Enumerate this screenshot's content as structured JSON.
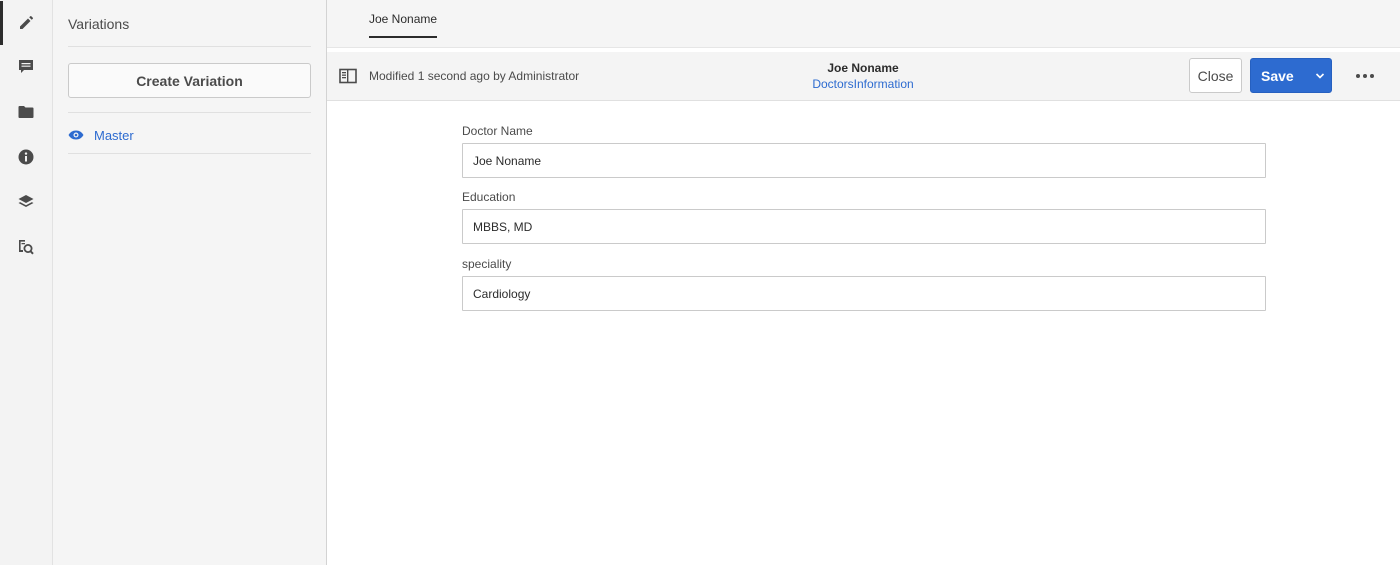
{
  "rail": {
    "items": [
      {
        "icon": "pencil-icon",
        "active": true
      },
      {
        "icon": "comment-icon",
        "active": false
      },
      {
        "icon": "folder-icon",
        "active": false
      },
      {
        "icon": "info-icon",
        "active": false
      },
      {
        "icon": "layers-icon",
        "active": false
      },
      {
        "icon": "search-document-icon",
        "active": false
      }
    ]
  },
  "variations": {
    "title": "Variations",
    "create_label": "Create Variation",
    "items": [
      {
        "label": "Master",
        "icon": "eye-icon"
      }
    ]
  },
  "tabs": [
    {
      "label": "Joe Noname",
      "active": true
    }
  ],
  "actionbar": {
    "modified_text": "Modified 1 second ago by Administrator",
    "fragment_name": "Joe Noname",
    "model_name": "DoctorsInformation",
    "close_label": "Close",
    "save_label": "Save"
  },
  "form": {
    "fields": [
      {
        "label": "Doctor Name",
        "value": "Joe Noname"
      },
      {
        "label": "Education",
        "value": "MBBS, MD"
      },
      {
        "label": "speciality",
        "value": "Cardiology"
      }
    ]
  },
  "colors": {
    "accent": "#2d6bd0",
    "rail_bg": "#f3f3f3",
    "panel_bg": "#f5f5f5"
  }
}
